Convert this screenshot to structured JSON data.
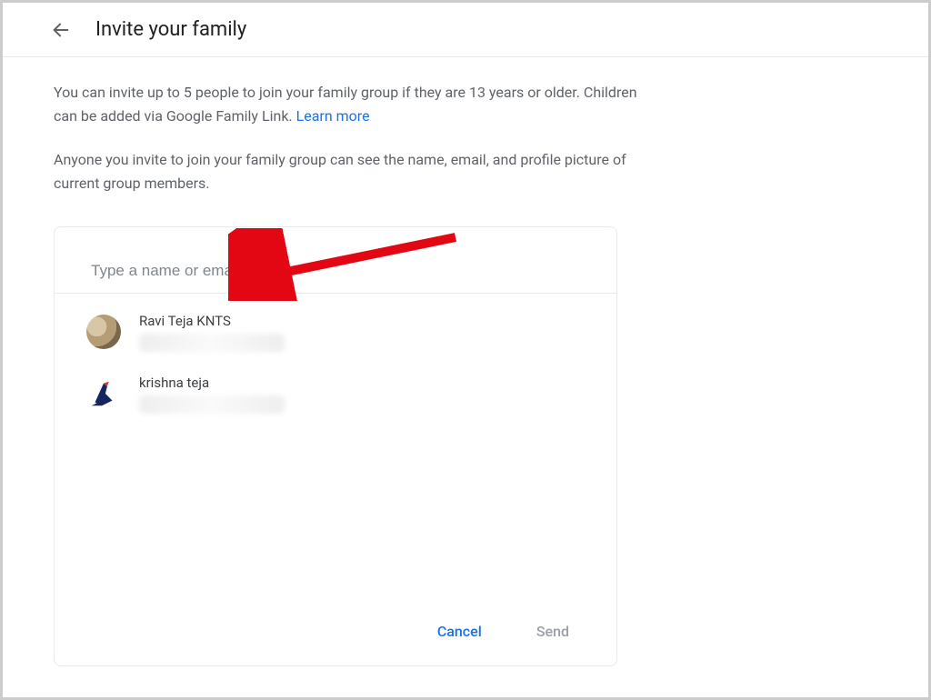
{
  "header": {
    "title": "Invite your family"
  },
  "description": {
    "line1": "You can invite up to 5 people to join your family group if they are 13 years or older. Children can be added via Google Family Link. ",
    "learn_more": "Learn more",
    "line2": "Anyone you invite to join your family group can see the name, email, and profile picture of current group members."
  },
  "input": {
    "placeholder": "Type a name or email",
    "value": ""
  },
  "suggestions": [
    {
      "name": "Ravi Teja KNTS"
    },
    {
      "name": "krishna teja"
    }
  ],
  "actions": {
    "cancel": "Cancel",
    "send": "Send"
  }
}
